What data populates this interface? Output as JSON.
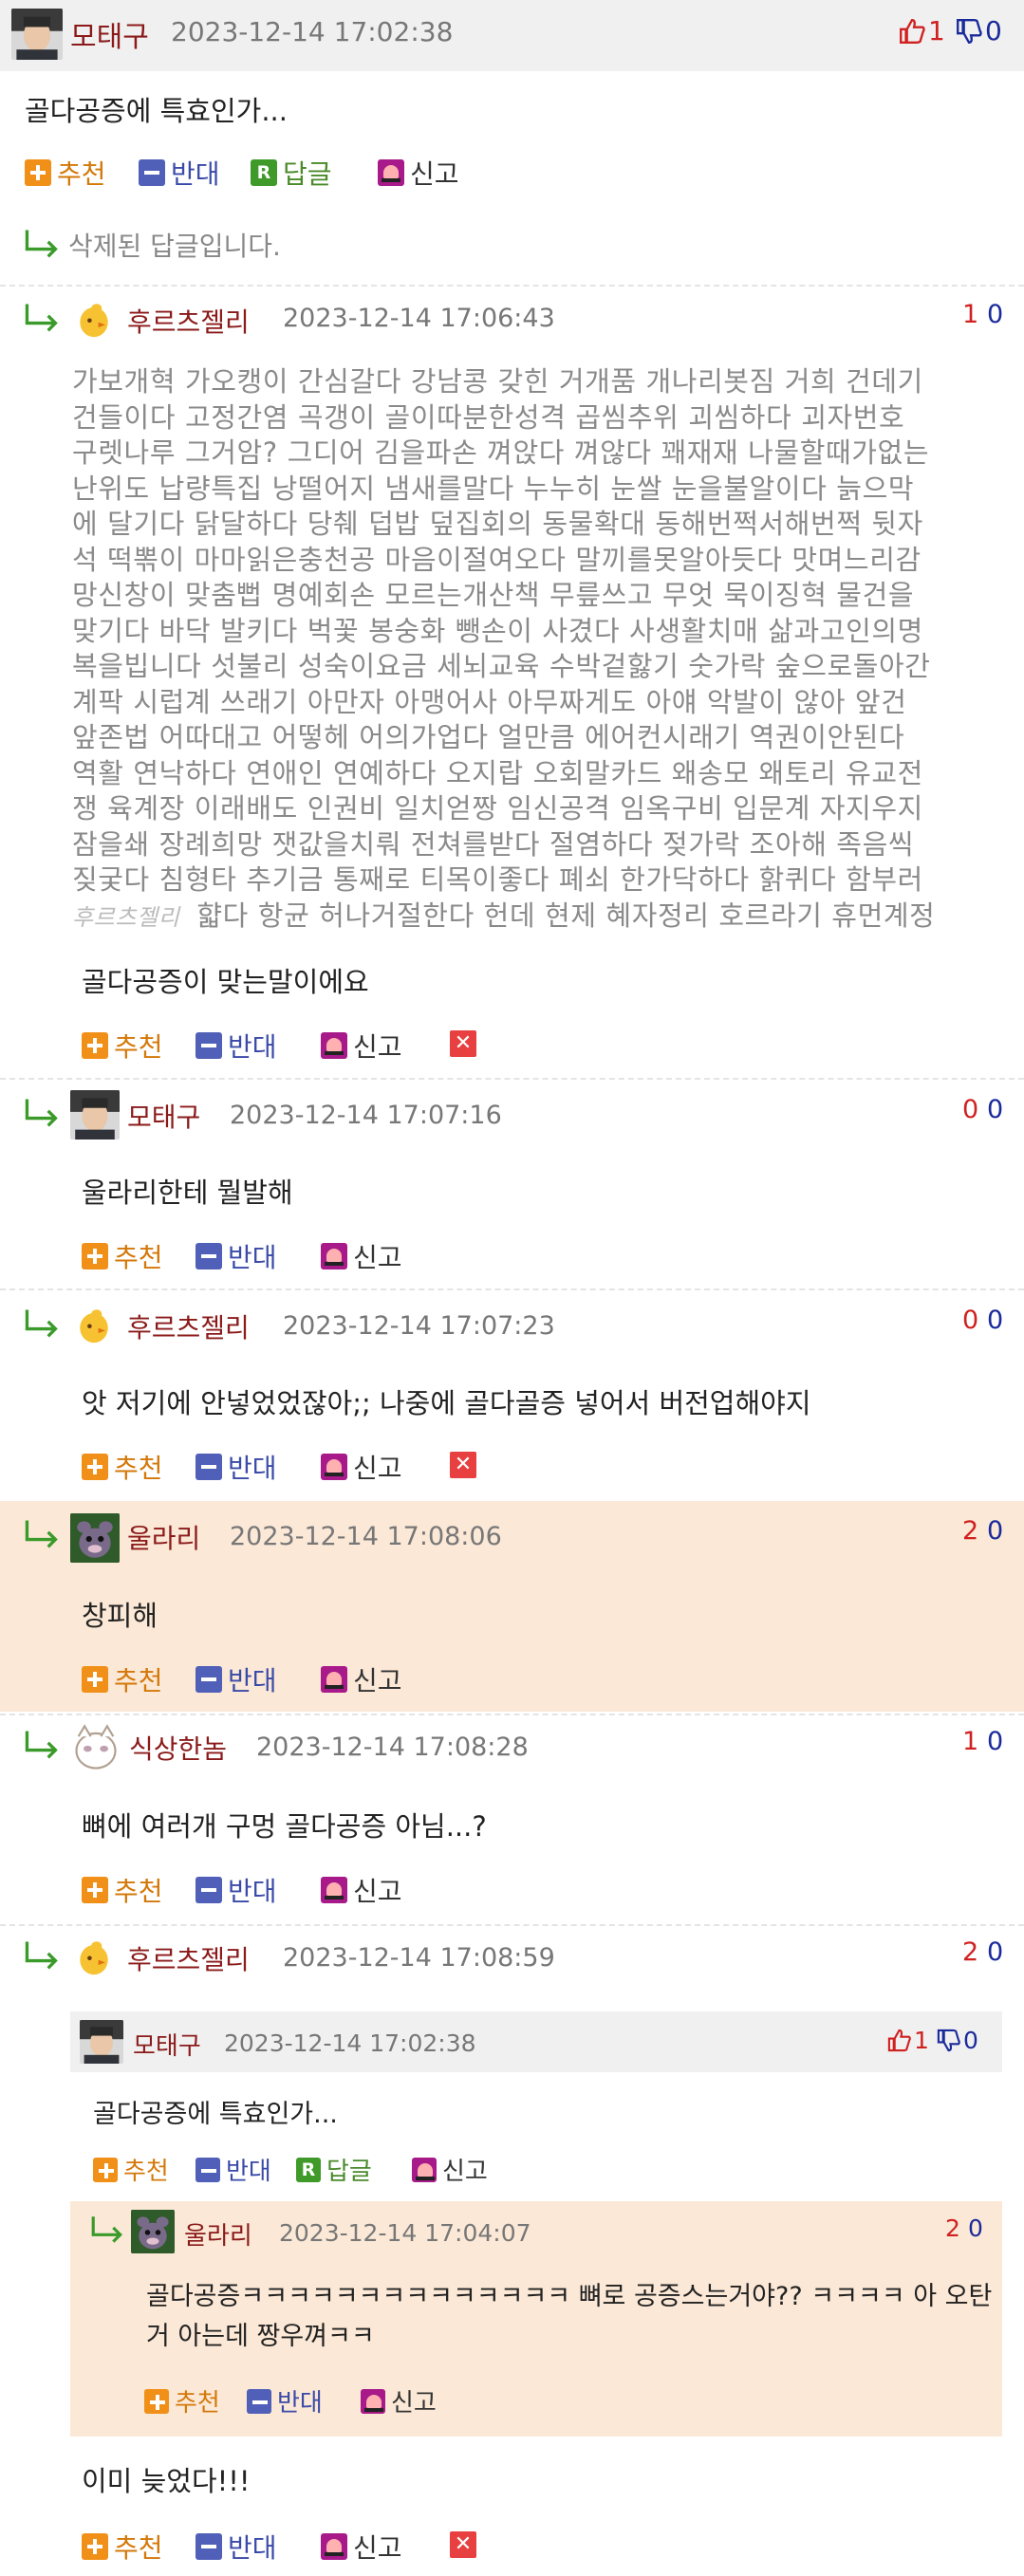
{
  "main": {
    "author": "모태구",
    "date": "2023-12-14 17:02:38",
    "up": "1",
    "down": "0",
    "text": "골다공증에 특효인가..."
  },
  "actions": {
    "recommend": "추천",
    "oppose": "반대",
    "reply": "답글",
    "report": "신고",
    "reply_icon_letter": "R",
    "delete_icon": "✕"
  },
  "deleted_text": "삭제된 답글입니다.",
  "comments": [
    {
      "author": "후르츠젤리",
      "date": "2023-12-14 17:06:43",
      "up": "1",
      "down": "0",
      "signature": "후르츠젤리",
      "long_lines": [
        "가보개혁 가오캥이 간심갈다 강남콩 갖힌 거개품 개나리봇짐 거희 건데기",
        "건들이다 고정간염 곡갱이 골이따분한성격 곱씸추위 괴씸하다 괴자번호",
        "구렛나루 그거암? 그디어 김을파손 껴앉다 껴않다 꽤재재 나물할때가없는",
        "난위도 납량특집 낭떨어지 냄새를말다 누누히 눈쌀 눈을불알이다 늙으막",
        "에 달기다 닭달하다 당췌 덥밥 덮집회의 동물확대 동해번쩍서해번쩍 뒷자",
        "석 떡뽂이 마마읽은충천공 마음이절여오다 말끼를못알아듯다 맛며느리감",
        "망신창이 맞춤뻡 명예회손 모르는개산책 무릎쓰고 무엇 묵이징혁 물건을",
        "맞기다 바닥 발키다 벅꽃 봉숭화 뺑손이 사겼다 사생활치매 삶과고인의명",
        "복을빕니다 섯불리 성숙이요금 세뇌교육 수박겉핧기 숫가락 숲으로돌아간",
        "계팍 시럽계 쓰래기 아만자 아맹어사 아무짜게도 아얘 악발이 않아 앞건",
        "앞존법 어따대고 어떻헤 어의가업다 얼만큼 에어컨시래기 역권이안된다",
        "역활 연낙하다 연애인 연예하다 오지랍 오회말카드 왜송모 왜토리 유교전",
        "쟁 육계장 이래배도 인권비 일치얻짱 임신공격 임옥구비 입문계 자지우지",
        "잠을쇄 장례희망 잿값을치뤄 전쳐를받다 절염하다 젖가락 조아해 족음씩",
        "짖궂다 침형타 추기금 통째로 티목이좋다 폐쇠 한가닥하다 핡퀴다 함부러",
        "햛다 항균 허나거절한다 헌데 현제 혜자정리 호르라기 휴먼계정"
      ],
      "text": "골다공증이 맞는말이에요"
    },
    {
      "author": "모태구",
      "date": "2023-12-14 17:07:16",
      "up": "0",
      "down": "0",
      "text": "울라리한테 뭘발해"
    },
    {
      "author": "후르츠젤리",
      "date": "2023-12-14 17:07:23",
      "up": "0",
      "down": "0",
      "text": "앗 저기에 안넣었었잖아;; 나중에 골다골증 넣어서 버전업해야지"
    },
    {
      "author": "울라리",
      "date": "2023-12-14 17:08:06",
      "up": "2",
      "down": "0",
      "text": "창피해"
    },
    {
      "author": "식상한놈",
      "date": "2023-12-14 17:08:28",
      "up": "1",
      "down": "0",
      "text": "뼈에 여러개 구멍 골다공증 아님...?"
    },
    {
      "author": "후르츠젤리",
      "date": "2023-12-14 17:08:59",
      "up": "2",
      "down": "0",
      "text": "이미 늦었다!!!",
      "quote": {
        "author": "모태구",
        "date": "2023-12-14 17:02:38",
        "up": "1",
        "down": "0",
        "text": "골다공증에 특효인가...",
        "reply": {
          "author": "울라리",
          "date": "2023-12-14 17:04:07",
          "up": "2",
          "down": "0",
          "text_line1": "골다공증ㅋㅋㅋㅋㅋㅋㅋㅋㅋㅋㅋㅋㅋㅋ 뼈로 공증스는거야?? ㅋㅋㅋㅋ 아 오탄",
          "text_line2": "거 아는데 짱우껴ㅋㅋ"
        }
      }
    }
  ],
  "colors": {
    "nick": "#8b1a1a",
    "vote_up": "#d02020",
    "vote_down": "#1a2a9a",
    "highlight_bg": "#fbe8d6",
    "header_bg": "#f0f0f0"
  }
}
